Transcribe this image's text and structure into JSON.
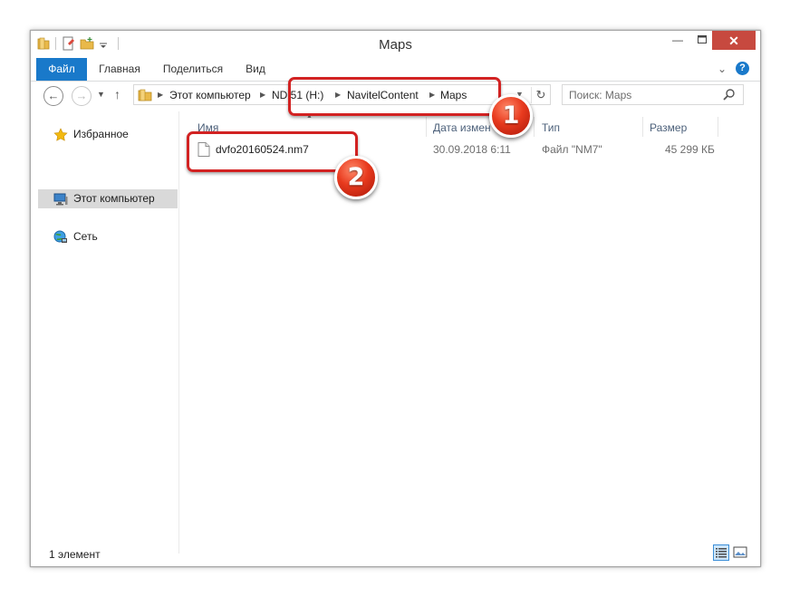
{
  "window": {
    "title": "Maps"
  },
  "ribbon": {
    "tabs": [
      {
        "label": "Файл"
      },
      {
        "label": "Главная"
      },
      {
        "label": "Поделиться"
      },
      {
        "label": "Вид"
      }
    ]
  },
  "navigation": {
    "breadcrumbs": [
      {
        "label": "Этот компьютер"
      },
      {
        "label": "ND 51 (H:)"
      },
      {
        "label": "NavitelContent"
      },
      {
        "label": "Maps"
      }
    ],
    "search_placeholder": "Поиск: Maps"
  },
  "sidebar": {
    "items": [
      {
        "label": "Избранное",
        "icon": "star-icon"
      },
      {
        "label": "Этот компьютер",
        "icon": "computer-icon",
        "selected": true
      },
      {
        "label": "Сеть",
        "icon": "network-icon"
      }
    ]
  },
  "file_list": {
    "columns": [
      {
        "label": "Имя"
      },
      {
        "label": "Дата измен"
      },
      {
        "label": "Тип"
      },
      {
        "label": "Размер"
      }
    ],
    "rows": [
      {
        "name": "dvfo20160524.nm7",
        "date": "30.09.2018 6:11",
        "type": "Файл \"NM7\"",
        "size": "45 299 КБ",
        "icon": "file-icon"
      }
    ]
  },
  "status": {
    "item_count": "1 элемент"
  },
  "callouts": [
    {
      "label": "1"
    },
    {
      "label": "2"
    }
  ],
  "colors": {
    "accent": "#1979ca",
    "callout_red": "#d22222",
    "close_button": "#c7493f"
  }
}
